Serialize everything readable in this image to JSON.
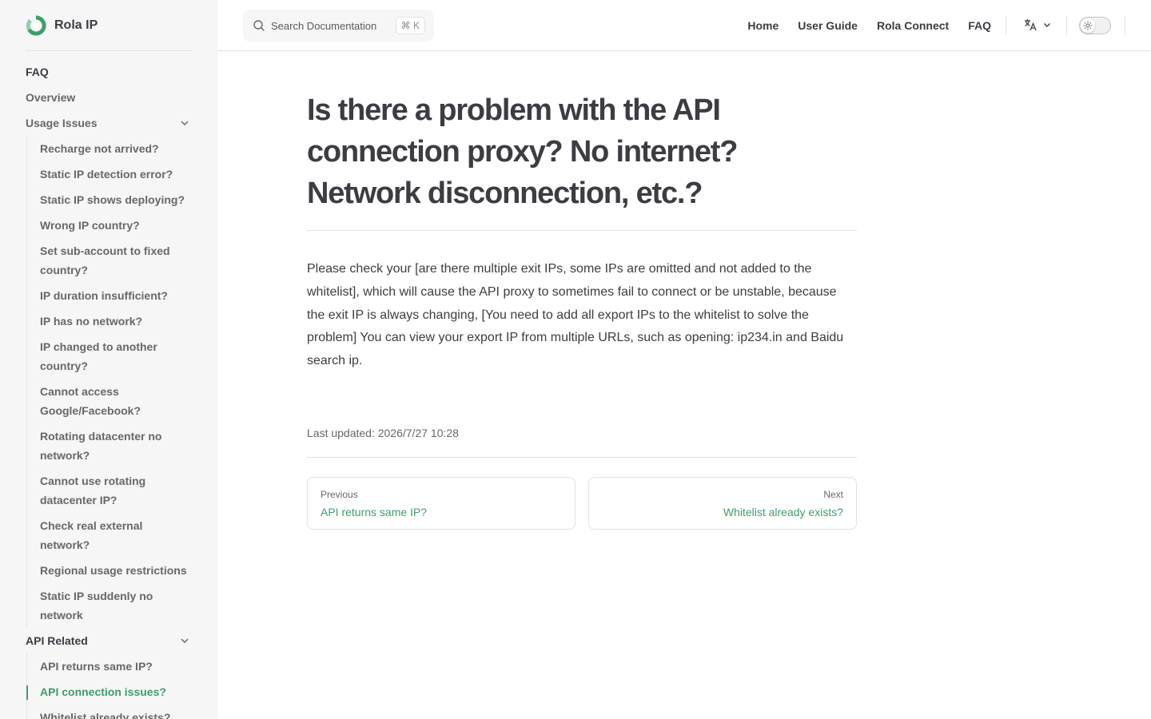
{
  "brand": {
    "name": "Rola IP"
  },
  "sidebar": {
    "heading": "FAQ",
    "overview": "Overview",
    "groups": [
      {
        "label": "Usage Issues",
        "items": [
          "Recharge not arrived?",
          "Static IP detection error?",
          "Static IP shows deploying?",
          "Wrong IP country?",
          "Set sub-account to fixed country?",
          "IP duration insufficient?",
          "IP has no network?",
          "IP changed to another country?",
          "Cannot access Google/Facebook?",
          "Rotating datacenter no network?",
          "Cannot use rotating datacenter IP?",
          "Check real external network?",
          "Regional usage restrictions",
          "Static IP suddenly no network"
        ]
      },
      {
        "label": "API Related",
        "items": [
          "API returns same IP?",
          "API connection issues?",
          "Whitelist already exists?"
        ],
        "active_index": 1
      }
    ]
  },
  "search": {
    "placeholder": "Search Documentation",
    "shortcut": "⌘ K"
  },
  "topnav": {
    "items": [
      "Home",
      "User Guide",
      "Rola Connect",
      "FAQ"
    ]
  },
  "page": {
    "title": "Is there a problem with the API connection proxy? No internet? Network disconnection, etc.?",
    "body": "Please check your [are there multiple exit IPs, some IPs are omitted and not added to the whitelist], which will cause the API proxy to sometimes fail to connect or be unstable, because the exit IP is always changing, [You need to add all export IPs to the whitelist to solve the problem] You can view your export IP from multiple URLs, such as opening: ip234.in and Baidu search ip.",
    "last_updated": "Last updated: 2026/7/27 10:28"
  },
  "pager": {
    "prev": {
      "label": "Previous",
      "title": "API returns same IP?"
    },
    "next": {
      "label": "Next",
      "title": "Whitelist already exists?"
    }
  },
  "colors": {
    "accent": "#3f9d6a",
    "text": "#3c3c43",
    "sidebar_bg": "#f6f6f7"
  }
}
